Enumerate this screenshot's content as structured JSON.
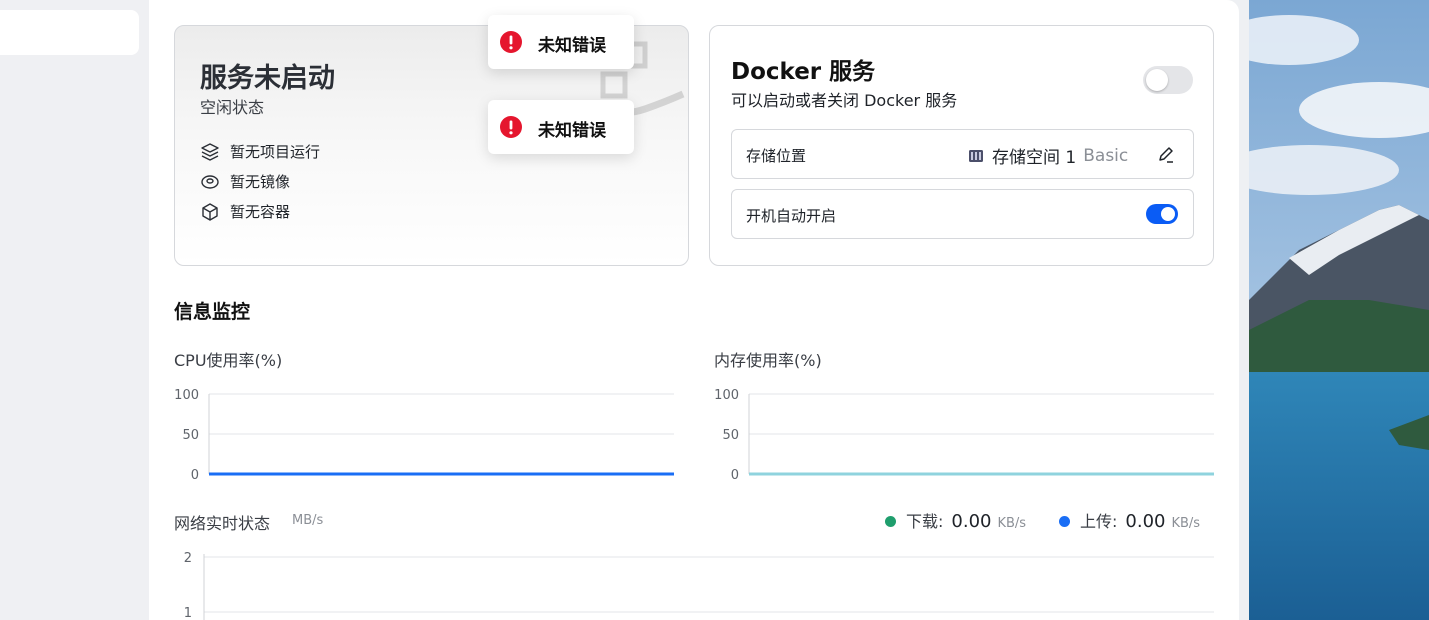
{
  "status": {
    "title": "服务未启动",
    "subtitle": "空闲状态",
    "items": [
      {
        "icon": "layers-icon",
        "label": "暂无项目运行"
      },
      {
        "icon": "disk-icon",
        "label": "暂无镜像"
      },
      {
        "icon": "cube-icon",
        "label": "暂无容器"
      }
    ]
  },
  "docker": {
    "title": "Docker 服务",
    "subtitle": "可以启动或者关闭 Docker 服务",
    "service_enabled": false,
    "storage": {
      "label": "存储位置",
      "value": "存储空间 1",
      "tag": "Basic"
    },
    "autostart": {
      "label": "开机自动开启",
      "enabled": true
    }
  },
  "toasts": [
    {
      "icon": "error-icon",
      "text": "未知错误"
    },
    {
      "icon": "error-icon",
      "text": "未知错误"
    }
  ],
  "monitor": {
    "title": "信息监控",
    "cpu": {
      "title": "CPU使用率(%)",
      "y_ticks": [
        "100",
        "50",
        "0"
      ],
      "color": "#1a6ef5"
    },
    "memory": {
      "title": "内存使用率(%)",
      "y_ticks": [
        "100",
        "50",
        "0"
      ],
      "color": "#8fd3de"
    },
    "network": {
      "title": "网络实时状态",
      "unit": "MB/s",
      "y_ticks": [
        "2",
        "1"
      ],
      "download": {
        "label": "下载:",
        "value": "0.00",
        "unit": "KB/s",
        "color": "#1f9e6d"
      },
      "upload": {
        "label": "上传:",
        "value": "0.00",
        "unit": "KB/s",
        "color": "#1a6ef5"
      }
    }
  },
  "chart_data": [
    {
      "type": "line",
      "title": "CPU使用率(%)",
      "ylim": [
        0,
        100
      ],
      "series": [
        {
          "values": [
            0,
            0,
            0,
            0,
            0,
            0,
            0,
            0,
            0,
            0,
            0
          ]
        }
      ]
    },
    {
      "type": "line",
      "title": "内存使用率(%)",
      "ylim": [
        0,
        100
      ],
      "series": [
        {
          "values": [
            0,
            0,
            0,
            0,
            0,
            0,
            0,
            0,
            0,
            0,
            0
          ]
        }
      ]
    },
    {
      "type": "line",
      "title": "网络实时状态",
      "ylim": [
        0,
        2
      ],
      "series": [
        {
          "name": "下载",
          "values": []
        },
        {
          "name": "上传",
          "values": []
        }
      ]
    }
  ]
}
